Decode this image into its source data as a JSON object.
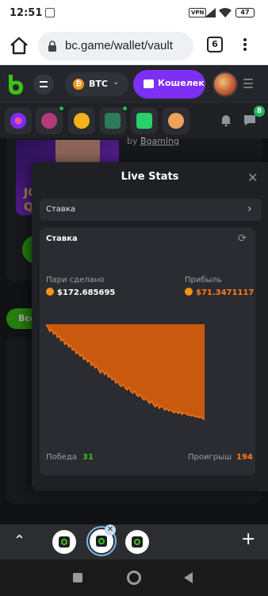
{
  "status_bar": {
    "time": "12:51",
    "vpn_label": "VPN",
    "battery": "47"
  },
  "browser": {
    "url": "bc.game/wallet/vault",
    "tab_count": "6"
  },
  "header": {
    "currency": "BTC",
    "wallet_label": "Кошелек"
  },
  "notifications": {
    "chat_badge": "8"
  },
  "background": {
    "provider_prefix": "by ",
    "provider_name": "Bgaming",
    "banner_text": "JO\nQ",
    "filter_chip": "Все"
  },
  "live_stats": {
    "title": "Live Stats",
    "dropdown_value": "Ставка",
    "card_title": "Ставка",
    "wagered_label": "Пари сделано",
    "wagered_value": "$172.685695",
    "profit_label": "Прибыль",
    "profit_value": "$71.3471117",
    "wins_label": "Победа",
    "wins_value": "31",
    "losses_label": "Проигрыш",
    "losses_value": "194"
  },
  "colors": {
    "accent_purple": "#7d2ff5",
    "profit_orange": "#ff7a1a",
    "chart_fill": "#c9590f",
    "win_green": "#3bc117",
    "btc_orange": "#f7931a"
  },
  "chart_data": {
    "type": "area",
    "description_series": "cumulative profit",
    "y": [
      0,
      -4,
      -9,
      -6,
      -12,
      -10,
      -16,
      -14,
      -20,
      -18,
      -24,
      -22,
      -27,
      -25,
      -31,
      -29,
      -35,
      -33,
      -38,
      -36,
      -42,
      -40,
      -45,
      -43,
      -49,
      -47,
      -52,
      -50,
      -55,
      -58,
      -54,
      -60,
      -57,
      -63,
      -61,
      -66,
      -64,
      -70,
      -68,
      -72,
      -74,
      -71,
      -76,
      -78,
      -75,
      -80,
      -82,
      -79,
      -84,
      -86,
      -83,
      -88,
      -90,
      -87,
      -92,
      -94,
      -91,
      -96,
      -98,
      -95,
      -100,
      -97,
      -99,
      -102,
      -100,
      -103,
      -101,
      -104,
      -105,
      -103,
      -106,
      -104,
      -107,
      -105,
      -106,
      -108,
      -107,
      -109,
      -108,
      -110,
      -109,
      -111,
      -110,
      -112,
      -113
    ]
  }
}
